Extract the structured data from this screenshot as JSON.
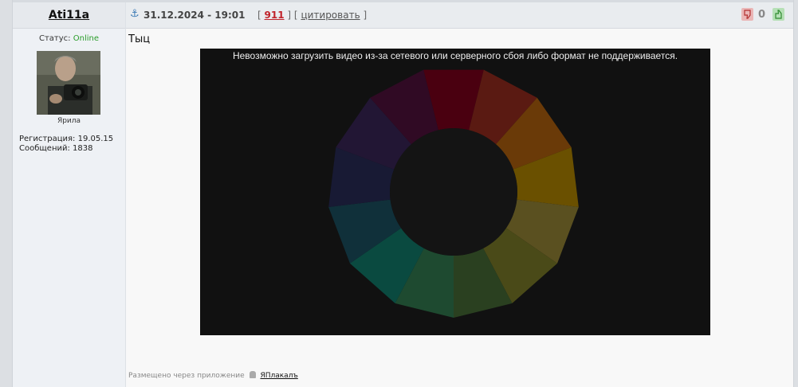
{
  "author": {
    "name": "Ati11a",
    "status_label": "Статус:",
    "status_value": "Online",
    "avatar_caption": "Ярила",
    "registration": "Регистрация: 19.05.15",
    "messages": "Сообщений: 1838"
  },
  "post": {
    "date": "31.12.2024 - 19:01",
    "bracket_open": "[",
    "number": "911",
    "bracket_close": "]",
    "quote_open": "[",
    "quote_label": "цитировать",
    "quote_close": "]",
    "rating": "0",
    "text": "Тыц",
    "video_error": "Невозможно загрузить видео из-за сетевого или серверного сбоя либо формат не поддерживается.",
    "footer_label": "Размещено через приложение",
    "footer_app": "ЯПлакалъ"
  },
  "colors": {
    "online": "#2a9d2a",
    "post_number": "#c0222a",
    "anchor": "#3b7ab5",
    "wheel": [
      "#4a0010",
      "#5a1a12",
      "#6a3a08",
      "#6a5000",
      "#5a5020",
      "#4a4a18",
      "#2a4020",
      "#1e4a30",
      "#0a4a40",
      "#10303a",
      "#181a34",
      "#221634",
      "#300a24"
    ]
  }
}
